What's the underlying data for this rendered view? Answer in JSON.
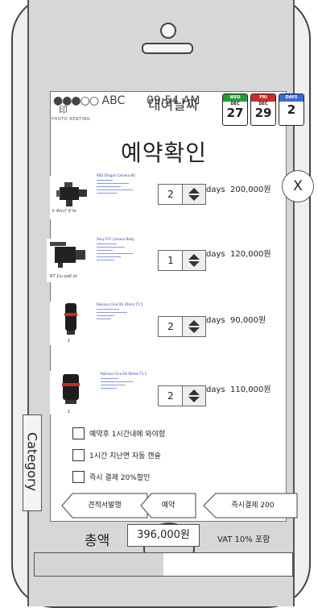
{
  "status": {
    "dots": "●●●○○",
    "carrier": "ABC",
    "time": "09:54 AM"
  },
  "app": {
    "icon": "印",
    "sub": "PHOTO RENTING"
  },
  "header": {
    "rent_label": "대여날짜",
    "close_label": "X"
  },
  "calendars": [
    {
      "head": "WED",
      "month": "DEC",
      "day": "27",
      "color": "#2a9a3a"
    },
    {
      "head": "FRI",
      "month": "DEC",
      "day": "29",
      "color": "#d02a2a"
    },
    {
      "head": "DAYS",
      "month": "",
      "day": "2",
      "color": "#3a6ad0"
    }
  ],
  "page": {
    "title": "예약확인"
  },
  "items": [
    {
      "caption": "× 4iu년 유 fu",
      "desc": "RED Dragon Camera Kit",
      "qty": "2",
      "unit": "days",
      "price": "200,000원",
      "icon": "cinema-camera-icon"
    },
    {
      "caption": "RT 1iu oalt ot",
      "desc": "Sony FS7 Camera Body",
      "qty": "1",
      "unit": "days",
      "price": "120,000원",
      "icon": "video-camera-icon"
    },
    {
      "caption": "1",
      "desc": "Rokinon Cine DS 35mm T1.5",
      "qty": "2",
      "unit": "days",
      "price": "90,000원",
      "icon": "lens-icon"
    },
    {
      "caption": "1",
      "desc": "Rokinon Cine DS 85mm T1.5",
      "qty": "2",
      "unit": "days",
      "price": "110,000원",
      "icon": "lens-icon"
    }
  ],
  "options": [
    {
      "label": "예약후 1시간내에 와야함"
    },
    {
      "label": "1시간 지난면 자동 캔슬"
    },
    {
      "label": "즉시 결제 20%할인"
    }
  ],
  "category_label": "Category",
  "actions": {
    "quote": "견적서발행",
    "reserve": "예약",
    "pay_now": "즉시결제 200"
  },
  "total": {
    "label": "총액",
    "value": "396,000원",
    "vat": "VAT 10% 포함"
  },
  "progress": {
    "fraction": 0.5
  }
}
